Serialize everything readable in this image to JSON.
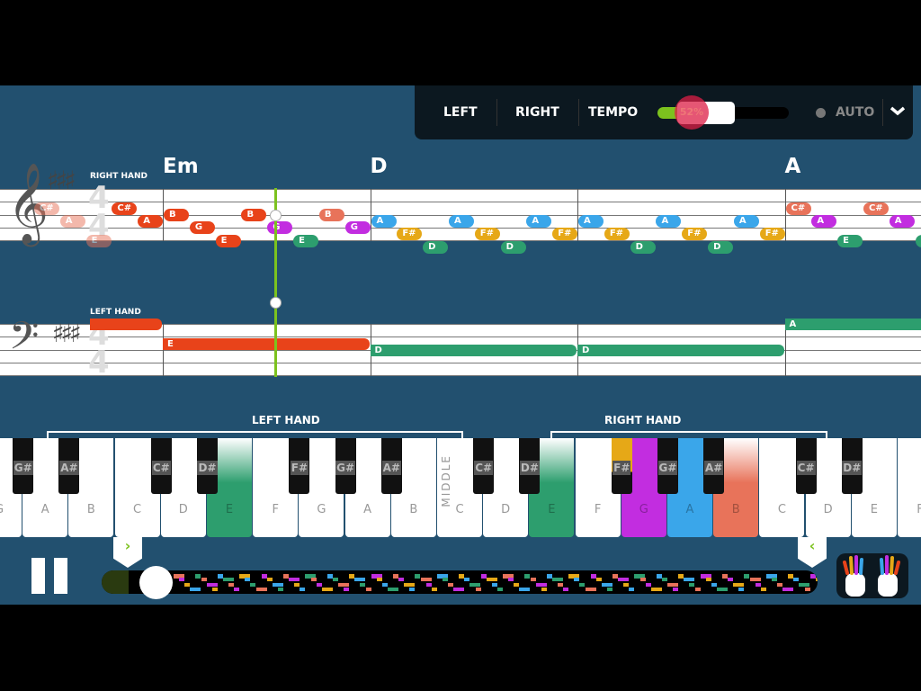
{
  "controls": {
    "left": "LEFT",
    "right": "RIGHT",
    "tempo": "TEMPO",
    "tempo_value": "52%",
    "tempo_percent": 52,
    "auto": "AUTO",
    "expand_icon": "chevron-down-icon"
  },
  "chords": [
    {
      "label": "Em",
      "measure": 1
    },
    {
      "label": "D",
      "measure": 2
    },
    {
      "label": "A",
      "measure": 4
    }
  ],
  "staff": {
    "right_hand": "RIGHT HAND",
    "left_hand": "LEFT HAND",
    "key_signature": "3 sharps",
    "time_signature": "4/4"
  },
  "colors": {
    "played": "#e8431a",
    "C#": "#e8735a",
    "B": "#e8735a",
    "G": "#c22de0",
    "E": "#2d9e6e",
    "D": "#2d9e6e",
    "A": "#3aa6ea",
    "F#": "#e6a817",
    "A_chord": "#c22de0",
    "bg": "#22506f",
    "playhead": "#7cc21e"
  },
  "right_hand_notes": [
    {
      "n": "C#",
      "m": 0,
      "e": 3,
      "s": 3,
      "c": "faded"
    },
    {
      "n": "A",
      "m": 0,
      "e": 4,
      "s": 5,
      "c": "faded"
    },
    {
      "n": "E",
      "m": 0,
      "e": 5,
      "s": 8,
      "c": "faded"
    },
    {
      "n": "C#",
      "m": 0,
      "e": 6,
      "s": 3,
      "c": "played"
    },
    {
      "n": "A",
      "m": 0,
      "e": 7,
      "s": 5,
      "c": "played"
    },
    {
      "n": "B",
      "m": 1,
      "e": 0,
      "s": 4,
      "c": "played"
    },
    {
      "n": "G",
      "m": 1,
      "e": 1,
      "s": 6,
      "c": "played"
    },
    {
      "n": "E",
      "m": 1,
      "e": 2,
      "s": 8,
      "c": "played"
    },
    {
      "n": "B",
      "m": 1,
      "e": 3,
      "s": 4,
      "c": "played"
    },
    {
      "n": "G",
      "m": 1,
      "e": 4,
      "s": 6,
      "c": "G"
    },
    {
      "n": "E",
      "m": 1,
      "e": 5,
      "s": 8,
      "c": "E"
    },
    {
      "n": "B",
      "m": 1,
      "e": 6,
      "s": 4,
      "c": "B"
    },
    {
      "n": "G",
      "m": 1,
      "e": 7,
      "s": 6,
      "c": "G"
    },
    {
      "n": "A",
      "m": 2,
      "e": 0,
      "s": 5,
      "c": "A"
    },
    {
      "n": "F#",
      "m": 2,
      "e": 1,
      "s": 7,
      "c": "F#"
    },
    {
      "n": "D",
      "m": 2,
      "e": 2,
      "s": 9,
      "c": "D"
    },
    {
      "n": "A",
      "m": 2,
      "e": 3,
      "s": 5,
      "c": "A"
    },
    {
      "n": "F#",
      "m": 2,
      "e": 4,
      "s": 7,
      "c": "F#"
    },
    {
      "n": "D",
      "m": 2,
      "e": 5,
      "s": 9,
      "c": "D"
    },
    {
      "n": "A",
      "m": 2,
      "e": 6,
      "s": 5,
      "c": "A"
    },
    {
      "n": "F#",
      "m": 2,
      "e": 7,
      "s": 7,
      "c": "F#"
    },
    {
      "n": "A",
      "m": 3,
      "e": 0,
      "s": 5,
      "c": "A"
    },
    {
      "n": "F#",
      "m": 3,
      "e": 1,
      "s": 7,
      "c": "F#"
    },
    {
      "n": "D",
      "m": 3,
      "e": 2,
      "s": 9,
      "c": "D"
    },
    {
      "n": "A",
      "m": 3,
      "e": 3,
      "s": 5,
      "c": "A"
    },
    {
      "n": "F#",
      "m": 3,
      "e": 4,
      "s": 7,
      "c": "F#"
    },
    {
      "n": "D",
      "m": 3,
      "e": 5,
      "s": 9,
      "c": "D"
    },
    {
      "n": "A",
      "m": 3,
      "e": 6,
      "s": 5,
      "c": "A"
    },
    {
      "n": "F#",
      "m": 3,
      "e": 7,
      "s": 7,
      "c": "F#"
    },
    {
      "n": "C#",
      "m": 4,
      "e": 0,
      "s": 3,
      "c": "C#"
    },
    {
      "n": "A",
      "m": 4,
      "e": 1,
      "s": 5,
      "c": "A_chord"
    },
    {
      "n": "E",
      "m": 4,
      "e": 2,
      "s": 8,
      "c": "E"
    },
    {
      "n": "C#",
      "m": 4,
      "e": 3,
      "s": 3,
      "c": "C#"
    },
    {
      "n": "A",
      "m": 4,
      "e": 4,
      "s": 5,
      "c": "A_chord"
    },
    {
      "n": "E",
      "m": 4,
      "e": 5,
      "s": 8,
      "c": "E"
    }
  ],
  "left_hand_notes": [
    {
      "n": "",
      "m": 0,
      "start": 5,
      "len": 3,
      "s": 0,
      "c": "played"
    },
    {
      "n": "E",
      "m": 1,
      "start": 0,
      "len": 8,
      "s": 3,
      "c": "played"
    },
    {
      "n": "D",
      "m": 2,
      "start": 0,
      "len": 8,
      "s": 4,
      "c": "D"
    },
    {
      "n": "D",
      "m": 3,
      "start": 0,
      "len": 8,
      "s": 4,
      "c": "D"
    },
    {
      "n": "A",
      "m": 4,
      "start": 0,
      "len": 8,
      "s": 0,
      "c": "D"
    }
  ],
  "keyboard": {
    "left_hand": "LEFT HAND",
    "right_hand": "RIGHT HAND",
    "middle": "MIDDLE",
    "white_keys": [
      "G",
      "A",
      "B",
      "C",
      "D",
      "E",
      "F",
      "G",
      "A",
      "B",
      "C",
      "D",
      "E",
      "F",
      "G",
      "A",
      "B",
      "C",
      "D",
      "E",
      "F"
    ],
    "black_keys": [
      {
        "label": "G#",
        "after": 0
      },
      {
        "label": "A#",
        "after": 1
      },
      {
        "label": "C#",
        "after": 3
      },
      {
        "label": "D#",
        "after": 4
      },
      {
        "label": "F#",
        "after": 6
      },
      {
        "label": "G#",
        "after": 7
      },
      {
        "label": "A#",
        "after": 8
      },
      {
        "label": "C#",
        "after": 10
      },
      {
        "label": "D#",
        "after": 11
      },
      {
        "label": "F#",
        "after": 13
      },
      {
        "label": "G#",
        "after": 14
      },
      {
        "label": "A#",
        "after": 15
      },
      {
        "label": "C#",
        "after": 17
      },
      {
        "label": "D#",
        "after": 18
      }
    ],
    "highlighted_white": [
      {
        "index": 5,
        "color": "#2d9e6e"
      },
      {
        "index": 12,
        "color": "#2d9e6e"
      },
      {
        "index": 14,
        "color": "#c22de0"
      },
      {
        "index": 15,
        "color": "#3aa6ea"
      },
      {
        "index": 16,
        "color": "#e8735a"
      }
    ],
    "highlighted_black": [
      {
        "index": 9,
        "color": "#e6a817"
      }
    ]
  },
  "playback": {
    "pause_icon": "pause-icon",
    "hands_icon": "hands-icon",
    "progress_percent": 4
  }
}
